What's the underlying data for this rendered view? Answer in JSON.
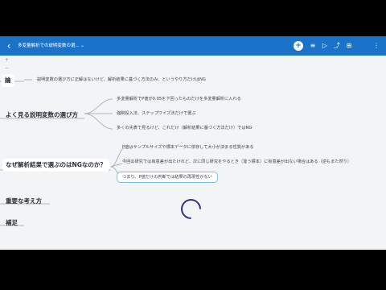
{
  "topbar": {
    "back_icon": "chevron-left-icon",
    "title": "多変量解析での説明変数の選...",
    "title_chevron": "⌄",
    "icons": [
      {
        "name": "add-icon",
        "glyph": "+"
      },
      {
        "name": "outline-icon",
        "glyph": "≡"
      },
      {
        "name": "play-icon",
        "glyph": "▷"
      },
      {
        "name": "share-icon",
        "glyph": "⤴"
      },
      {
        "name": "layout-icon",
        "glyph": "⊞"
      },
      {
        "name": "more-icon",
        "glyph": "⋮"
      }
    ]
  },
  "zoom": {
    "in": "+",
    "out": "−"
  },
  "nodes": {
    "conclusion": {
      "title": "論",
      "text": "説明変数の選び方に正解はないけど、解析結果に基づく方法のみ、というやり方だけはNG"
    },
    "common": {
      "title": "よく見る説明変数の選び方",
      "items": [
        "多変量解析でP値が0.05を下回ったものだけを多変量解析に入れる",
        "強制投入法、ステップワイズ法だけで選ぶ",
        "多くの先表で見るけど、これだけ（解析結果に基づく方法だけ）ではNG"
      ]
    },
    "why": {
      "title": "なぜ解析結果で選ぶのはNGなのか？",
      "items": [
        "P値はサンプルサイズや標本データに依存して大小が決まる性質がある",
        "今回の研究では有意差が出たけれど、次に同じ研究をやるとき（違う標本）に有意差が出ない場合はある（逆もまた然り）",
        "つまり、P値だけの判断では結果の再現性がない"
      ]
    },
    "important": {
      "title": "重要な考え方"
    },
    "supplement": {
      "title": "補足"
    }
  },
  "colors": {
    "topbar": "#1a73c9",
    "canvas": "#f3f4f6",
    "highlight_border": "#7ec3e6",
    "loader": "#2d2f8f"
  }
}
